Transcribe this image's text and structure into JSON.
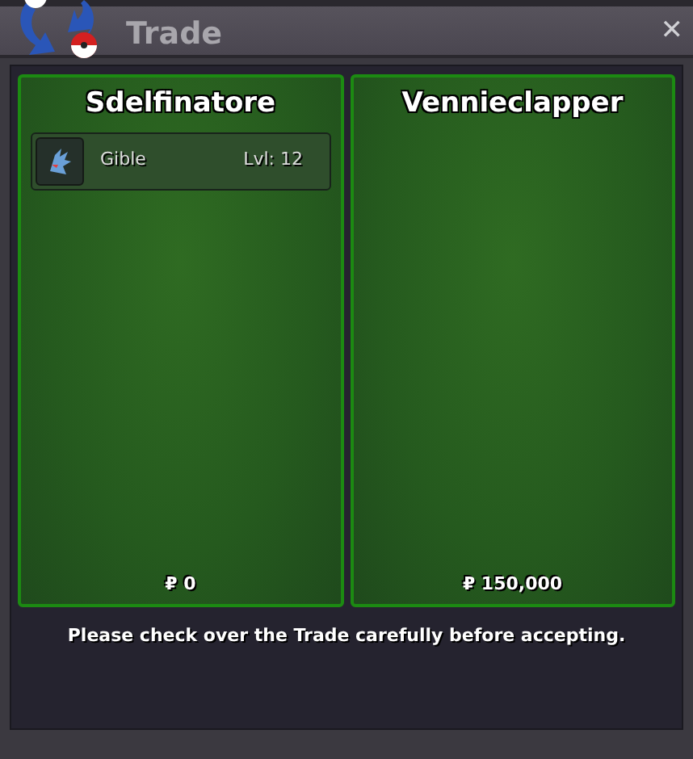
{
  "window": {
    "title": "Trade",
    "close": "✕"
  },
  "offers": [
    {
      "trainer": "Sdelfinatore",
      "pokemon": [
        {
          "name": "Gible",
          "level": "Lvl: 12"
        }
      ],
      "money": "₽ 0"
    },
    {
      "trainer": "Vennieclapper",
      "money": "₽ 150,000"
    }
  ],
  "message": "Please check over the Trade carefully before accepting."
}
